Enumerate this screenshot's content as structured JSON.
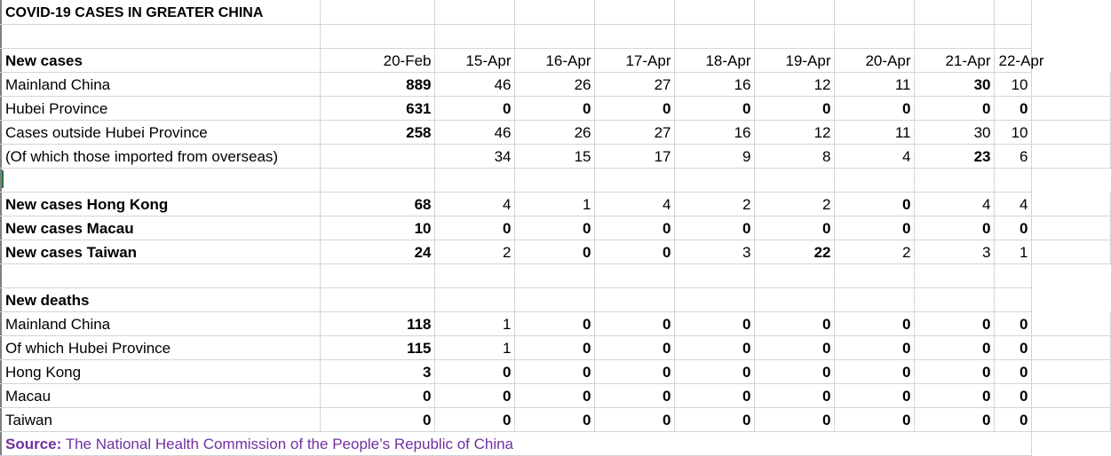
{
  "title": "COVID-19 CASES IN GREATER CHINA",
  "dates": [
    "20-Feb",
    "15-Apr",
    "16-Apr",
    "17-Apr",
    "18-Apr",
    "19-Apr",
    "20-Apr",
    "21-Apr",
    "22-Apr"
  ],
  "colors": {
    "purple": "#7030a0",
    "red": "#ff0000",
    "gridline": "#d4d4d4"
  },
  "new_cases": {
    "header": "New cases",
    "rows": [
      {
        "label": "Mainland China",
        "feb": "889",
        "values": [
          "46",
          "26",
          "27",
          "16",
          "12",
          "11",
          "30",
          "10"
        ],
        "highlight": [
          false,
          false,
          false,
          false,
          false,
          false,
          true,
          false
        ]
      },
      {
        "label": "Hubei Province",
        "feb": "631",
        "values": [
          "0",
          "0",
          "0",
          "0",
          "0",
          "0",
          "0",
          "0"
        ],
        "highlight": [
          true,
          true,
          true,
          true,
          true,
          true,
          true,
          true
        ]
      },
      {
        "label": "Cases outside Hubei Province",
        "feb": "258",
        "values": [
          "46",
          "26",
          "27",
          "16",
          "12",
          "11",
          "30",
          "10"
        ],
        "highlight": [
          false,
          false,
          false,
          false,
          false,
          false,
          false,
          false
        ]
      },
      {
        "label": "(Of which those imported from overseas)",
        "feb": "",
        "values": [
          "34",
          "15",
          "17",
          "9",
          "8",
          "4",
          "23",
          "6"
        ],
        "highlight": [
          false,
          false,
          false,
          false,
          false,
          false,
          true,
          false
        ]
      }
    ]
  },
  "regional": {
    "rows": [
      {
        "label": "New cases Hong Kong",
        "feb": "68",
        "values": [
          "4",
          "1",
          "4",
          "2",
          "2",
          "0",
          "4",
          "4"
        ],
        "highlight": [
          false,
          false,
          false,
          false,
          false,
          true,
          false,
          false
        ]
      },
      {
        "label": "New cases Macau",
        "feb": "10",
        "values": [
          "0",
          "0",
          "0",
          "0",
          "0",
          "0",
          "0",
          "0"
        ],
        "highlight": [
          true,
          true,
          true,
          true,
          true,
          true,
          true,
          true
        ]
      },
      {
        "label": "New cases Taiwan",
        "feb": "24",
        "values": [
          "2",
          "0",
          "0",
          "3",
          "22",
          "2",
          "3",
          "1"
        ],
        "highlight": [
          false,
          true,
          true,
          false,
          true,
          false,
          false,
          false
        ]
      }
    ]
  },
  "new_deaths": {
    "header": "New deaths",
    "rows": [
      {
        "label": "Mainland China",
        "feb": "118",
        "values": [
          "1",
          "0",
          "0",
          "0",
          "0",
          "0",
          "0",
          "0"
        ],
        "highlight": [
          false,
          true,
          true,
          true,
          true,
          true,
          true,
          true
        ]
      },
      {
        "label": "Of which Hubei Province",
        "feb": "115",
        "values": [
          "1",
          "0",
          "0",
          "0",
          "0",
          "0",
          "0",
          "0"
        ],
        "highlight": [
          false,
          true,
          true,
          true,
          true,
          true,
          true,
          true
        ]
      },
      {
        "label": "Hong Kong",
        "feb": "3",
        "values": [
          "0",
          "0",
          "0",
          "0",
          "0",
          "0",
          "0",
          "0"
        ],
        "highlight": [
          true,
          true,
          true,
          true,
          true,
          true,
          true,
          true
        ]
      },
      {
        "label": "Macau",
        "feb": "0",
        "values": [
          "0",
          "0",
          "0",
          "0",
          "0",
          "0",
          "0",
          "0"
        ],
        "highlight": [
          true,
          true,
          true,
          true,
          true,
          true,
          true,
          true
        ]
      },
      {
        "label": "Taiwan",
        "feb": "0",
        "values": [
          "0",
          "0",
          "0",
          "0",
          "0",
          "0",
          "0",
          "0"
        ],
        "highlight": [
          true,
          true,
          true,
          true,
          true,
          true,
          true,
          true
        ]
      }
    ]
  },
  "source": {
    "label": "Source:",
    "text": "The National Health Commission of the People’s Republic of China"
  }
}
